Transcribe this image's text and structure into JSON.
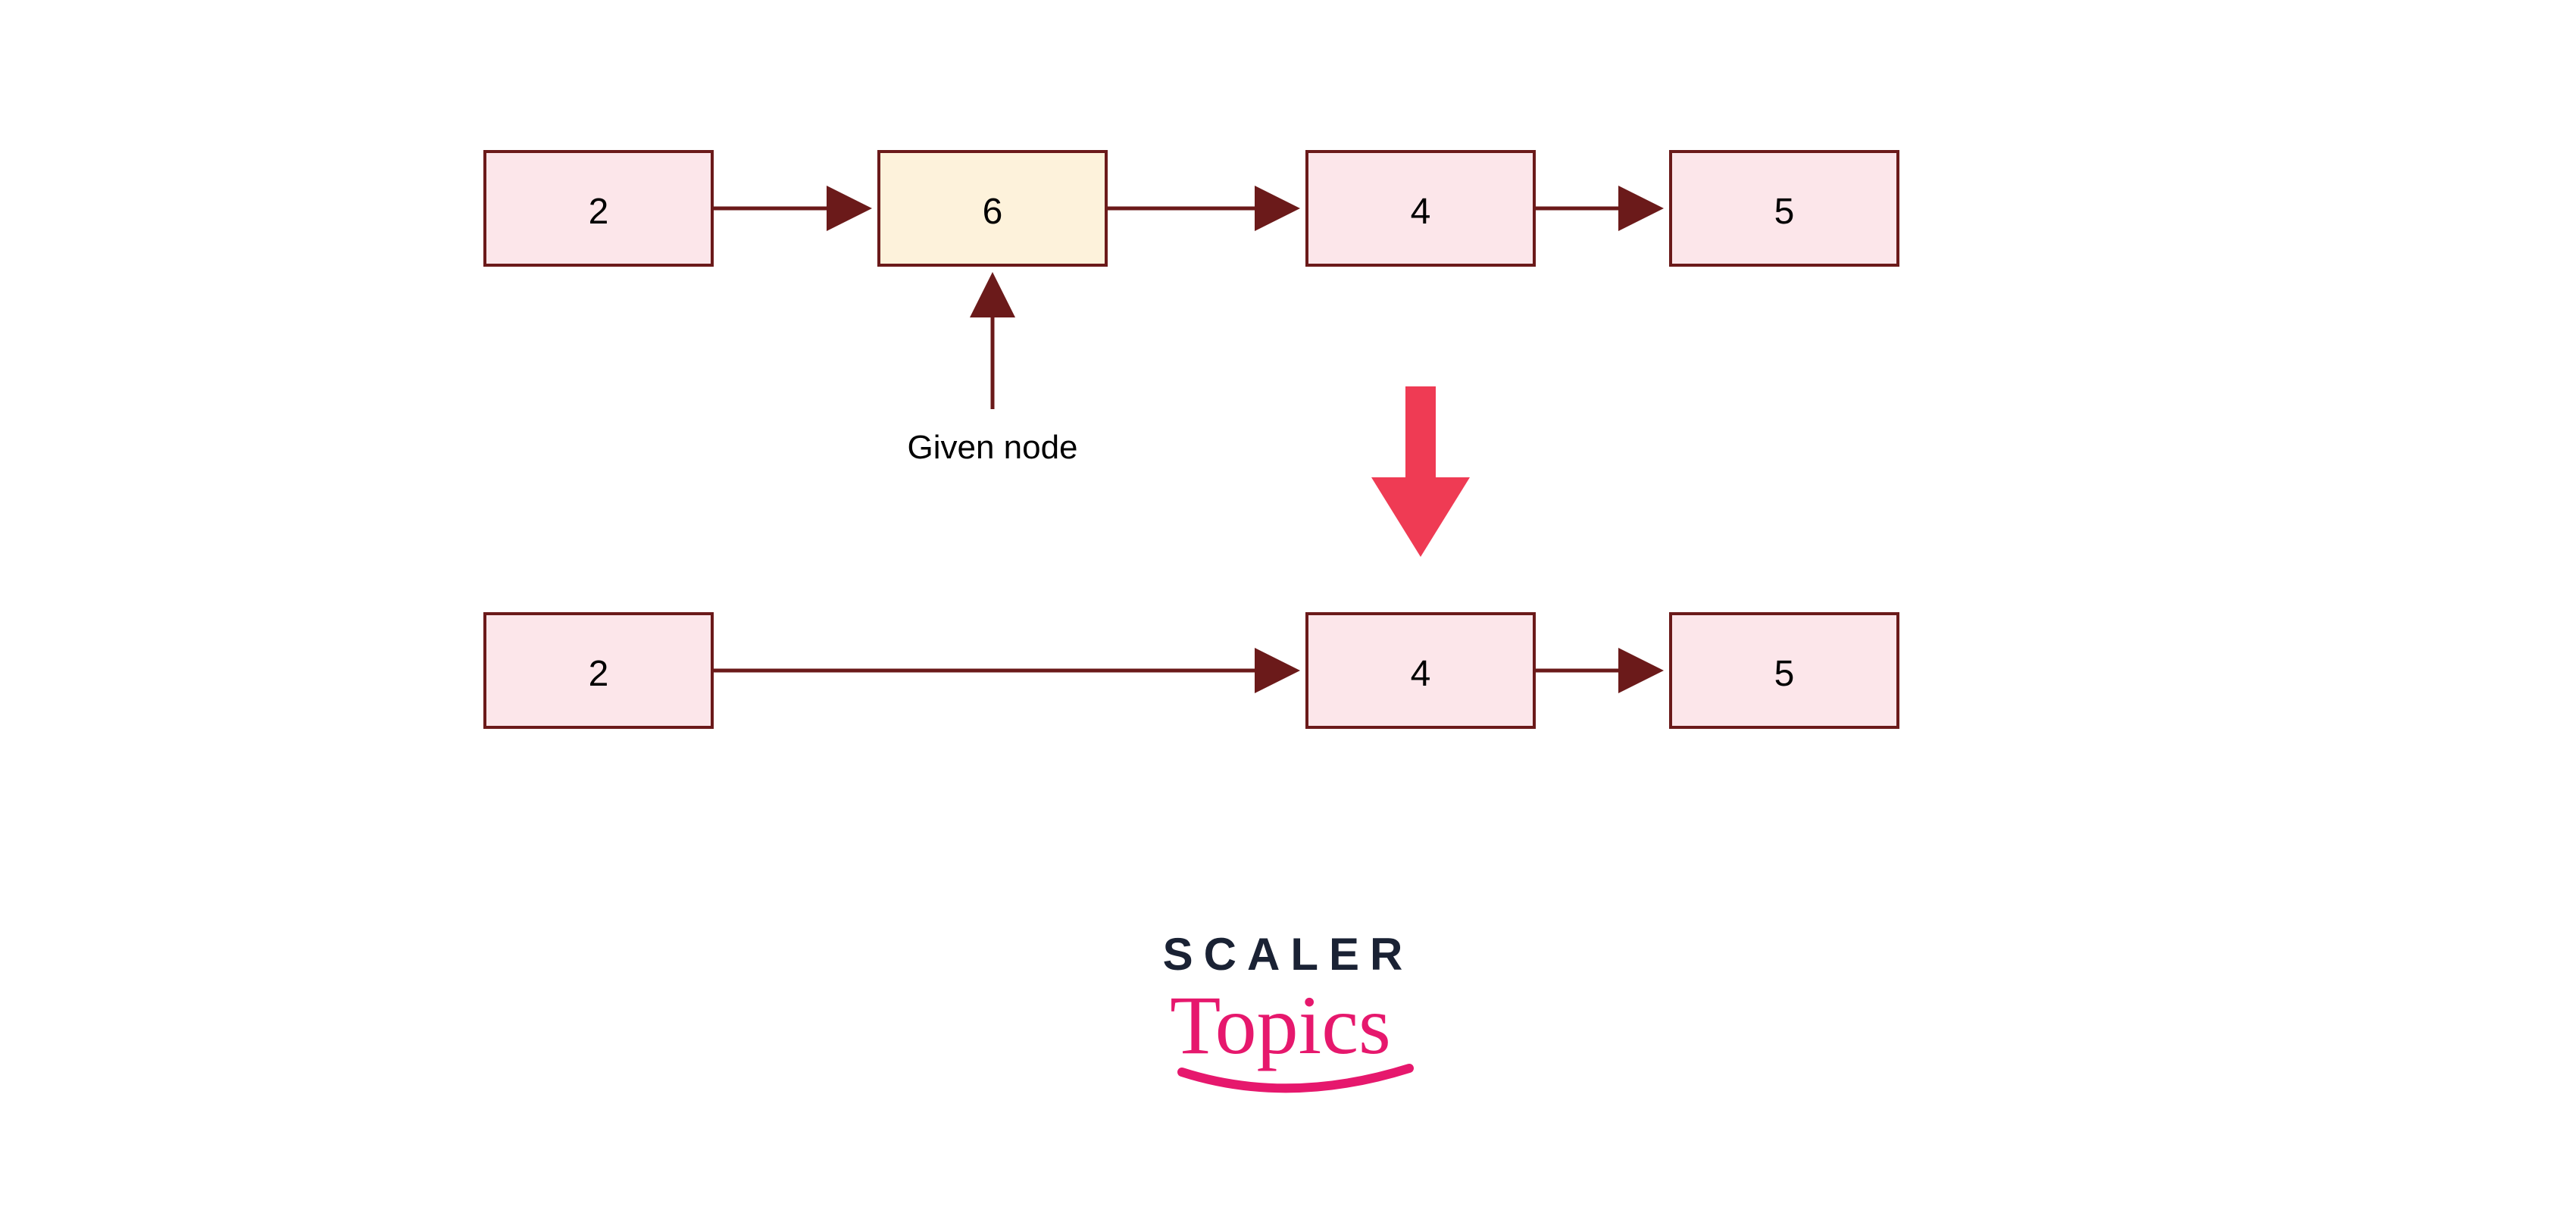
{
  "diagram": {
    "before": {
      "nodes": [
        {
          "id": "b0",
          "value": "2",
          "highlight": false
        },
        {
          "id": "b1",
          "value": "6",
          "highlight": true
        },
        {
          "id": "b2",
          "value": "4",
          "highlight": false
        },
        {
          "id": "b3",
          "value": "5",
          "highlight": false
        }
      ],
      "given_label": "Given node",
      "given_index": 1
    },
    "after": {
      "nodes": [
        {
          "id": "a0",
          "value": "2"
        },
        {
          "id": "a2",
          "value": "4"
        },
        {
          "id": "a3",
          "value": "5"
        }
      ]
    }
  },
  "colors": {
    "node_fill": "#fce6ea",
    "node_highlight_fill": "#fdf2db",
    "node_stroke": "#6b1a1a",
    "arrow_stroke": "#6b1a1a",
    "down_arrow_fill": "#ef3b54"
  },
  "logo": {
    "line1": "SCALER",
    "line2": "Topics"
  }
}
